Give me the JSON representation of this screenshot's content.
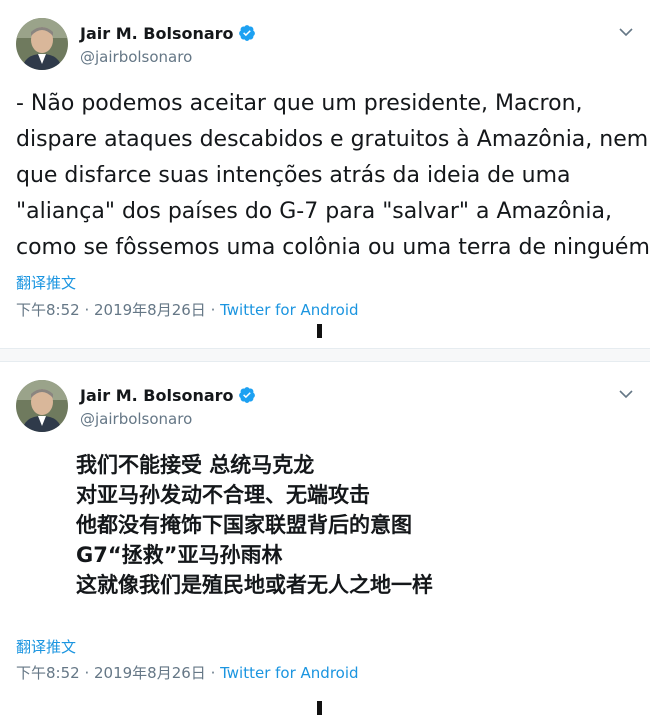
{
  "colors": {
    "link": "#1b95e0",
    "muted": "#657786",
    "text": "#14171a",
    "verified": "#1da1f2"
  },
  "tweets": [
    {
      "name": "Jair M. Bolsonaro",
      "handle": "@jairbolsonaro",
      "text_lines": [
        "- Não podemos aceitar que um presidente, Macron,",
        "dispare ataques descabidos e gratuitos à Amazônia, nem",
        "que disfarce suas intenções atrás da ideia de uma",
        "\"aliança\" dos países do G-7 para \"salvar\" a Amazônia,",
        "como se fôssemos uma colônia ou uma terra de ninguém."
      ],
      "translate_label": "翻译推文",
      "time": "下午8:52 · 2019年8月26日",
      "separator": " · ",
      "source": "Twitter for Android"
    },
    {
      "name": "Jair M. Bolsonaro",
      "handle": "@jairbolsonaro",
      "text_lines": [
        "我们不能接受 总统马克龙",
        "对亚马孙发动不合理、无端攻击",
        "他都没有掩饰下国家联盟背后的意图",
        "G7“拯救”亚马孙雨林",
        "这就像我们是殖民地或者无人之地一样"
      ],
      "translate_label": "翻译推文",
      "time": "下午8:52 · 2019年8月26日",
      "separator": " · ",
      "source": "Twitter for Android"
    }
  ]
}
